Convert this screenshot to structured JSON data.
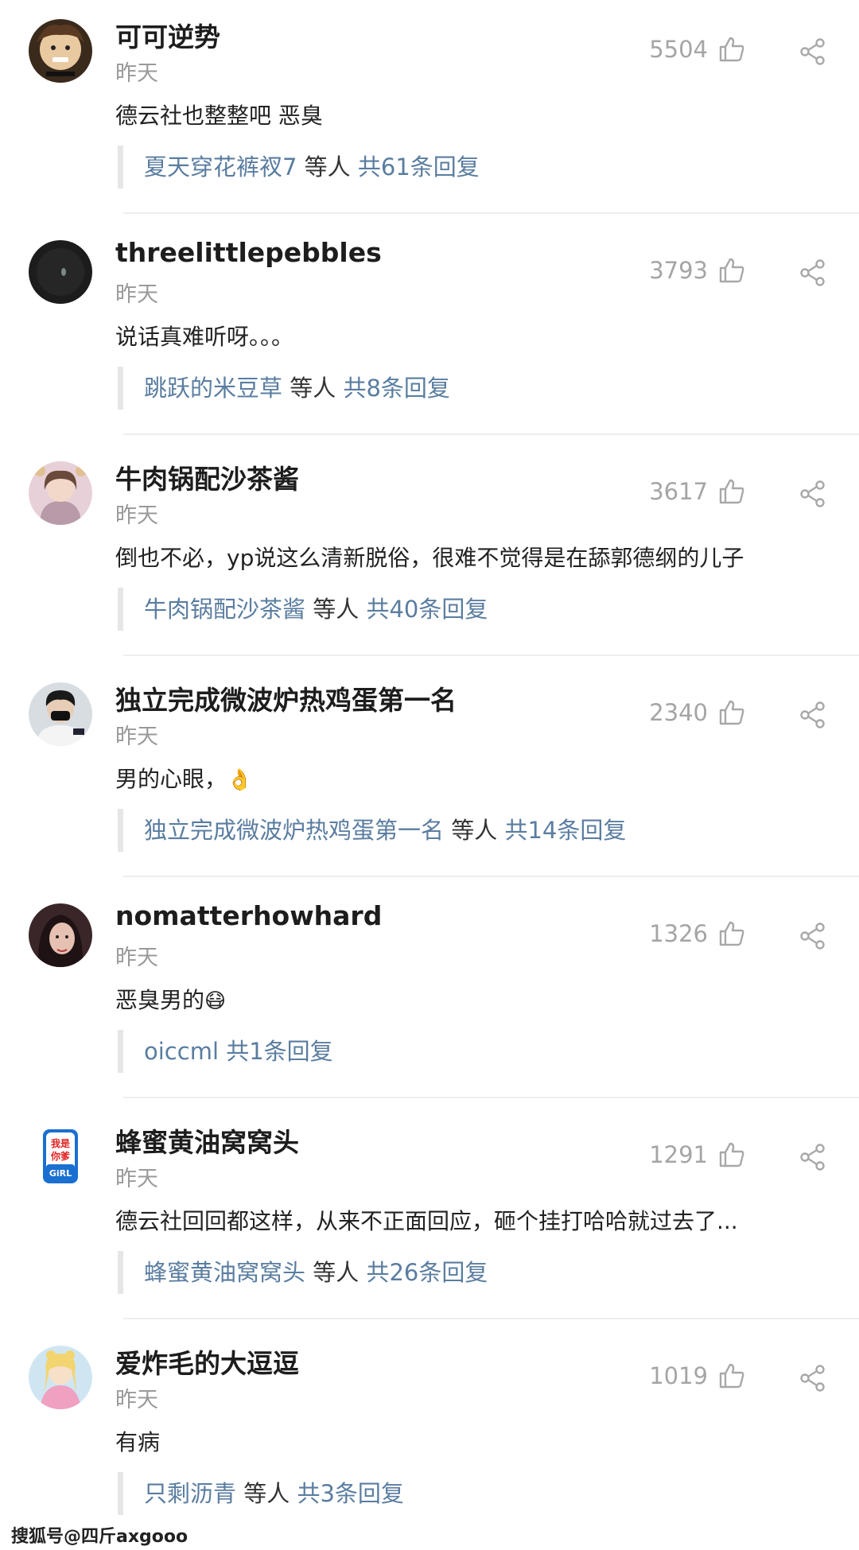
{
  "comments": [
    {
      "username": "可可逆势",
      "time": "昨天",
      "likes": "5504",
      "text": "德云社也整整吧 恶臭",
      "emoji": "",
      "reply_users": "夏天穿花裤衩7",
      "reply_mid": "等人",
      "reply_count": "共61条回复"
    },
    {
      "username": "threelittlepebbles",
      "time": "昨天",
      "likes": "3793",
      "text": "说话真难听呀。。。",
      "emoji": "",
      "reply_users": "跳跃的米豆草",
      "reply_mid": "等人",
      "reply_count": "共8条回复"
    },
    {
      "username": "牛肉锅配沙茶酱",
      "time": "昨天",
      "likes": "3617",
      "text": "倒也不必，yp说这么清新脱俗，很难不觉得是在舔郭德纲的儿子",
      "emoji": "",
      "reply_users": "牛肉锅配沙茶酱",
      "reply_mid": "等人",
      "reply_count": "共40条回复"
    },
    {
      "username": "独立完成微波炉热鸡蛋第一名",
      "time": "昨天",
      "likes": "2340",
      "text": "男的心眼，",
      "emoji": "👌",
      "reply_users": "独立完成微波炉热鸡蛋第一名",
      "reply_mid": "等人",
      "reply_count": "共14条回复"
    },
    {
      "username": "nomatterhowhard",
      "time": "昨天",
      "likes": "1326",
      "text": "恶臭男的",
      "emoji": "😷",
      "reply_users": "oiccml",
      "reply_mid": "",
      "reply_count": "共1条回复"
    },
    {
      "username": "蜂蜜黄油窝窝头",
      "time": "昨天",
      "likes": "1291",
      "text": "德云社回回都这样，从来不正面回应，砸个挂打哈哈就过去了...",
      "emoji": "",
      "reply_users": "蜂蜜黄油窝窝头",
      "reply_mid": "等人",
      "reply_count": "共26条回复"
    },
    {
      "username": "爱炸毛的大逗逗",
      "time": "昨天",
      "likes": "1019",
      "text": "有病",
      "emoji": "",
      "reply_users": "只剩沥青",
      "reply_mid": "等人",
      "reply_count": "共3条回复"
    }
  ],
  "avatar_6_text": [
    "我是",
    "你爹",
    "GiRL"
  ],
  "footer": "搜狐号@四斤axgooo",
  "colors": {
    "link": "#5a7da0",
    "muted": "#9a9a9a",
    "divider": "#eeeeee"
  }
}
